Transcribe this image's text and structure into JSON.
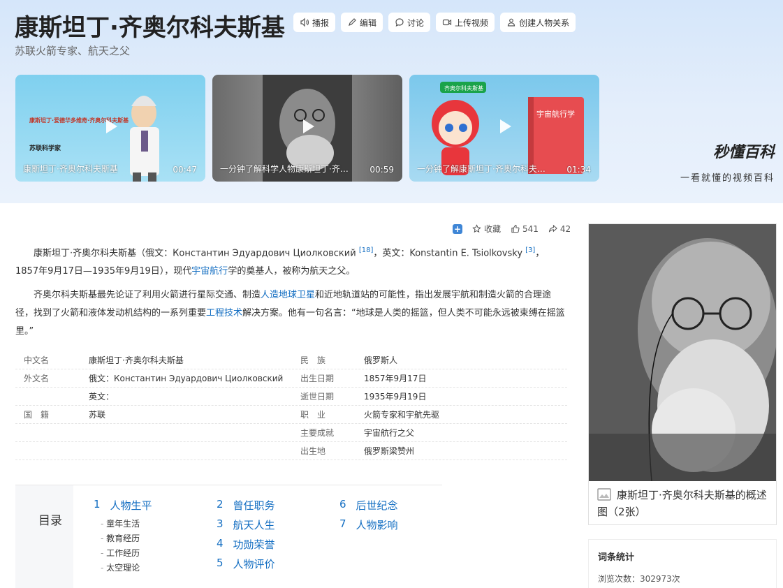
{
  "header": {
    "title": "康斯坦丁·齐奥尔科夫斯基",
    "subtitle": "苏联火箭专家、航天之父",
    "toolbar": [
      {
        "label": "播报",
        "icon": "speaker-icon"
      },
      {
        "label": "编辑",
        "icon": "pencil-icon"
      },
      {
        "label": "讨论",
        "icon": "chat-bubble-icon"
      },
      {
        "label": "上传视频",
        "icon": "video-camera-icon"
      },
      {
        "label": "创建人物关系",
        "icon": "people-icon"
      }
    ]
  },
  "videos": [
    {
      "title": "康斯坦丁·齐奥尔科夫斯基",
      "duration": "00:47",
      "overlay_title": "康斯坦丁·爱德华多维奇·齐奥尔科夫斯基",
      "overlay_sub": "苏联科学家"
    },
    {
      "title": "一分钟了解科学人物康斯坦丁·齐奥...",
      "duration": "00:59"
    },
    {
      "title": "一分钟了解康斯坦丁·齐奥尔科夫斯基",
      "duration": "01:34",
      "book_label": "宇宙航行学",
      "badge": "齐奥尔科夫斯基"
    }
  ],
  "brand": {
    "logo": "秒懂百科",
    "slogan": "一看就懂的视频百科"
  },
  "actions": {
    "collect": "收藏",
    "likes": "541",
    "shares": "42"
  },
  "summary": {
    "p1_a": "康斯坦丁·齐奥尔科夫斯基（俄文：Константин Эдуардович Циолковский ",
    "p1_ref1": "[18]",
    "p1_b": "，英文：Konstantin E. Tsiolkovsky ",
    "p1_ref2": "[3]",
    "p1_c": "，1857年9月17日—1935年9月19日），现代",
    "p1_link": "宇宙航行",
    "p1_d": "学的奠基人，被称为航天之父。",
    "p2_a": "齐奥尔科夫斯基最先论证了利用火箭进行星际交通、制造",
    "p2_link1": "人造地球卫星",
    "p2_b": "和近地轨道站的可能性，指出发展宇航和制造火箭的合理途径，找到了火箭和液体发动机结构的一系列重要",
    "p2_link2": "工程技术",
    "p2_c": "解决方案。他有一句名言：“地球是人类的摇篮，但人类不可能永远被束缚在摇篮里。”"
  },
  "infobox": {
    "left": [
      {
        "key": "中文名",
        "value": "康斯坦丁·齐奥尔科夫斯基"
      },
      {
        "key": "外文名",
        "value": "俄文：Константин Эдуардович Циолковский"
      },
      {
        "key": "",
        "value": "英文："
      },
      {
        "key": "国　籍",
        "value": "苏联"
      },
      {
        "key": "",
        "value": ""
      },
      {
        "key": "",
        "value": ""
      }
    ],
    "right": [
      {
        "key": "民　族",
        "value": "俄罗斯人"
      },
      {
        "key": "出生日期",
        "value": "1857年9月17日"
      },
      {
        "key": "逝世日期",
        "value": "1935年9月19日"
      },
      {
        "key": "职　业",
        "value": "火箭专家和宇航先驱"
      },
      {
        "key": "主要成就",
        "value": "宇宙航行之父"
      },
      {
        "key": "出生地",
        "value": "俄罗斯梁赞州"
      }
    ]
  },
  "toc": {
    "label": "目录",
    "col1": {
      "num": "1",
      "title": "人物生平",
      "subs": [
        "童年生活",
        "教育经历",
        "工作经历",
        "太空理论"
      ]
    },
    "col2": [
      {
        "num": "2",
        "title": "曾任职务"
      },
      {
        "num": "3",
        "title": "航天人生"
      },
      {
        "num": "4",
        "title": "功勋荣誉"
      },
      {
        "num": "5",
        "title": "人物评价"
      }
    ],
    "col3": [
      {
        "num": "6",
        "title": "后世纪念"
      },
      {
        "num": "7",
        "title": "人物影响"
      }
    ]
  },
  "sidebar": {
    "caption": "康斯坦丁·齐奥尔科夫斯基的概述图（2张）",
    "stats_title": "词条统计",
    "views_label": "浏览次数：302973次"
  },
  "colors": {
    "link": "#136ec2",
    "accent": "#3f86d6"
  }
}
